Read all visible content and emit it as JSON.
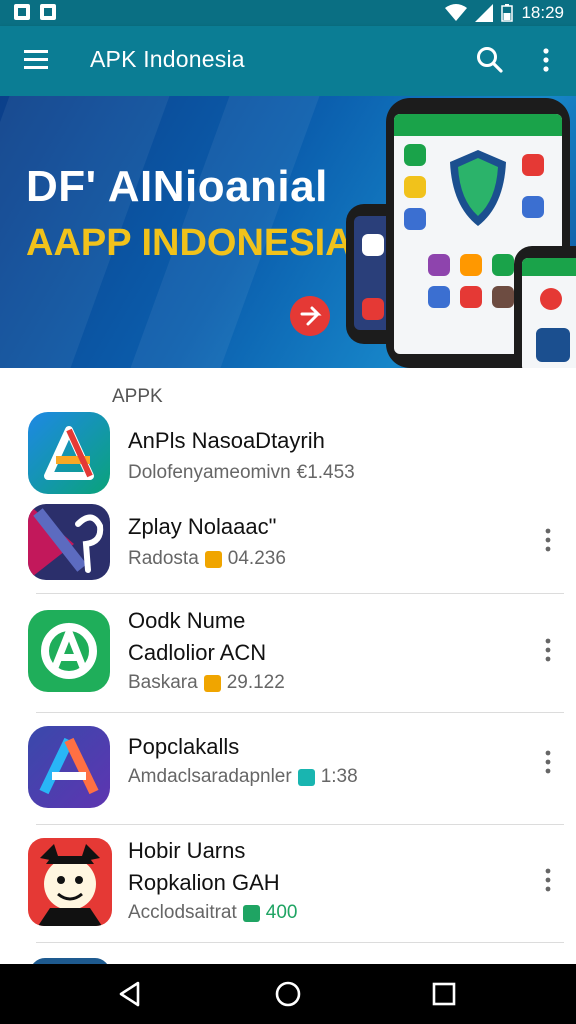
{
  "status_bar": {
    "time": "18:29",
    "icons": [
      "notification-icon",
      "notification-icon",
      "wifi-icon",
      "signal-icon",
      "battery-icon"
    ]
  },
  "app_bar": {
    "title": "APK Indonesia",
    "icons": [
      "menu-icon",
      "search-icon",
      "more-vert-icon"
    ],
    "color": "#0b7d94"
  },
  "banner": {
    "line1": "DF' AINioanial",
    "line2": "AAPP INDONESIA",
    "line1_color": "#ffffff",
    "line2_color": "#f1c21b"
  },
  "section": {
    "label": "APPK"
  },
  "apps": [
    {
      "line1": "AnPls NasoaDtayrih",
      "line2": "",
      "sub": "Dolofenyameomivn",
      "value": "€1.453",
      "badge_color": "",
      "has_menu": false
    },
    {
      "line1": "Zplay Nolaaac\"",
      "line2": "",
      "sub": "Radosta",
      "value": "04.236",
      "badge_color": "#f0a500",
      "has_menu": true
    },
    {
      "line1": "Oodk Nume",
      "line2": "Cadlolior ACN",
      "sub": "Baskara",
      "value": "29.122",
      "badge_color": "#f0a500",
      "has_menu": true
    },
    {
      "line1": "Popclakalls",
      "line2": "",
      "sub": "Amdaclsaradapnler",
      "value": "1:38",
      "badge_color": "#19b5b0",
      "has_menu": true
    },
    {
      "line1": "Hobir Uarns",
      "line2": "Ropkalion GAH",
      "sub": "Acclodsaitrat",
      "value": "400",
      "badge_color": "#1fa463",
      "value_color": "#1fa463",
      "has_menu": true
    }
  ],
  "nav_bar": {
    "icons": [
      "back-icon",
      "home-icon",
      "recents-icon"
    ]
  }
}
